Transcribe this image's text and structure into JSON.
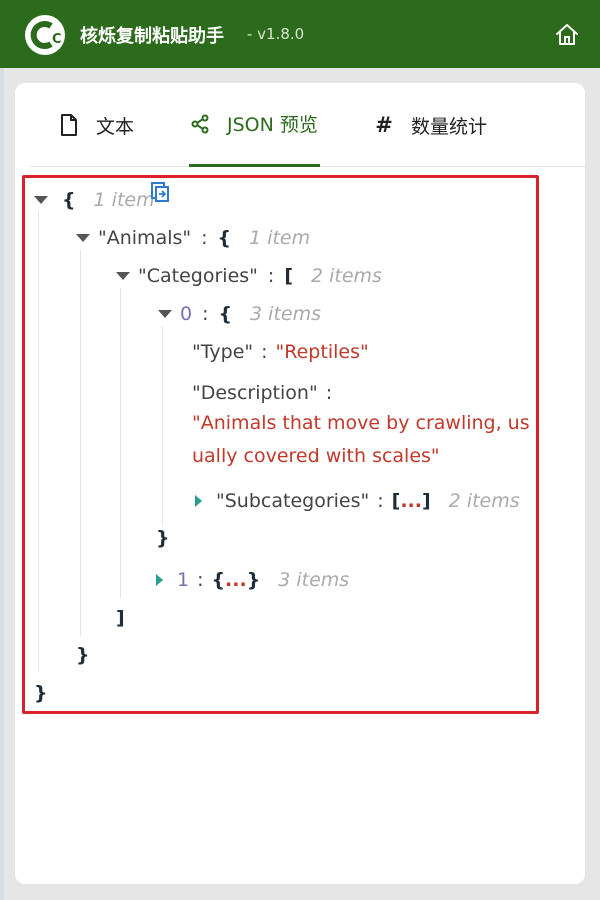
{
  "header": {
    "title": "核烁复制粘贴助手",
    "version": "- v1.8.0",
    "logo_text": "C",
    "home_icon": "home-icon"
  },
  "tabs": [
    {
      "label": "文本",
      "icon": "file-icon",
      "active": false
    },
    {
      "label": "JSON 预览",
      "icon": "share-nodes-icon",
      "active": true
    },
    {
      "label": "数量统计",
      "icon": "hash-icon",
      "active": false
    }
  ],
  "viewer": {
    "root": {
      "open": "{",
      "count": "1 item",
      "close": "}"
    },
    "animals": {
      "key": "\"Animals\"",
      "open": "{",
      "count": "1 item",
      "close": "}"
    },
    "categories": {
      "key": "\"Categories\"",
      "open": "[",
      "count": "2 items",
      "close": "]"
    },
    "item0": {
      "key": "0",
      "open": "{",
      "count": "3 items",
      "close": "}"
    },
    "type": {
      "key": "\"Type\"",
      "value": "\"Reptiles\""
    },
    "description": {
      "key": "\"Description\"",
      "value": "\"Animals that move by crawling, usually covered with scales\""
    },
    "subcategories": {
      "key": "\"Subcategories\"",
      "open": "[",
      "ellipsis": "...",
      "close": "]",
      "count": "2 items"
    },
    "item1": {
      "key": "1",
      "open": "{",
      "ellipsis": "...",
      "close": "}",
      "count": "3 items"
    },
    "colon": ":"
  },
  "colors": {
    "header": "#2c6a1c",
    "accent": "#2c6a1c",
    "highlight_border": "#d8232a",
    "string": "#c0392b"
  }
}
